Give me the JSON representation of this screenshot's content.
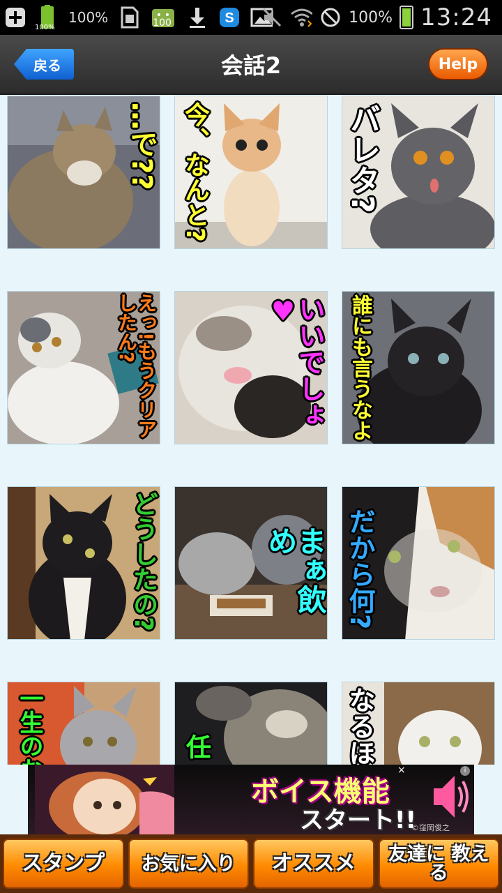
{
  "status_bar": {
    "left_icons": [
      "plus-icon",
      "battery-icon",
      "android-icon",
      "sim-icon",
      "android-icon",
      "download-icon",
      "skype-icon",
      "image-icon"
    ],
    "battery_small_label": "100%",
    "sim_pct": "100%",
    "app_badge": "100",
    "battery_pct": "100%",
    "time": "13:24"
  },
  "header": {
    "back_label": "戻る",
    "title": "会話2",
    "help_label": "Help"
  },
  "stamps": [
    {
      "text": "…で??",
      "text_color": "#ffff33"
    },
    {
      "text": "今、なんと?",
      "text_color": "#ffff33"
    },
    {
      "text": "バレタ?",
      "text_color": "#ffffff"
    },
    {
      "text": "えっ!もうクリアしたん?",
      "text_color": "#ff7a1a"
    },
    {
      "text": "いいでしょ♥",
      "text_color": "#ff33ff"
    },
    {
      "text": "誰にも言うなよ",
      "text_color": "#ffff33"
    },
    {
      "text": "どうしたの?",
      "text_color": "#33cc33"
    },
    {
      "text": "まぁ飲め",
      "text_color": "#33ffff"
    },
    {
      "text": "だから何?",
      "text_color": "#33aaff"
    },
    {
      "text": "一生のお",
      "text_color": "#33ff33"
    },
    {
      "text": "任",
      "text_color": "#33ff33"
    },
    {
      "text": "なるほ",
      "text_color": "#ffffff"
    }
  ],
  "ad": {
    "title": "ボイス機能",
    "subtitle": "スタート!!",
    "credit": "©窪岡俊之 ©NBGI",
    "close_label": "×",
    "info_label": "i"
  },
  "tabs": [
    {
      "label": "スタンプ"
    },
    {
      "label": "お気に入り"
    },
    {
      "label": "オススメ"
    },
    {
      "label": "友達に 教える"
    }
  ]
}
